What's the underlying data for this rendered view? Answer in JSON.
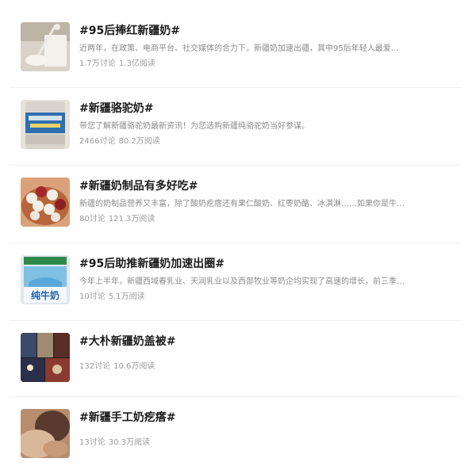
{
  "topics": [
    {
      "title": "#95后捧红新疆奶#",
      "desc": "近两年，在政策、电商平台、社交媒体的合力下，新疆奶加速出疆，其中95后年轻人最爱…",
      "discussions": "1.7万讨论",
      "reads": "1.3亿阅读",
      "image": "milk-pour-image"
    },
    {
      "title": "#新疆骆驼奶#",
      "desc": "带您了解新疆骆驼奶最新资讯！为您选购新疆纯骆驼奶当好参谋。",
      "discussions": "2466讨论",
      "reads": "80.2万阅读",
      "image": "camel-milk-can-image"
    },
    {
      "title": "#新疆奶制品有多好吃#",
      "desc": "新疆的奶制品营养又丰富，除了酸奶疙瘩还有果仁酸奶、红枣奶酪、冰淇淋……如果你是牛…",
      "discussions": "80讨论",
      "reads": "121.3万阅读",
      "image": "dairy-snacks-image"
    },
    {
      "title": "#95后助推新疆奶加速出圈#",
      "desc": "今年上半年，新疆西域春乳业、天润乳业以及西部牧业等奶企均实现了高速的增长，前三季…",
      "discussions": "10讨论",
      "reads": "5.1万阅读",
      "image": "milk-bag-image",
      "image_text": "纯牛奶"
    },
    {
      "title": "#大朴新疆奶盖被#",
      "desc": "",
      "discussions": "132讨论",
      "reads": "10.6万阅读",
      "image": "quilt-collage-image"
    },
    {
      "title": "#新疆手工奶疙瘩#",
      "desc": "",
      "discussions": "13讨论",
      "reads": "30.3万阅读",
      "image": "handmade-cheese-image"
    }
  ]
}
